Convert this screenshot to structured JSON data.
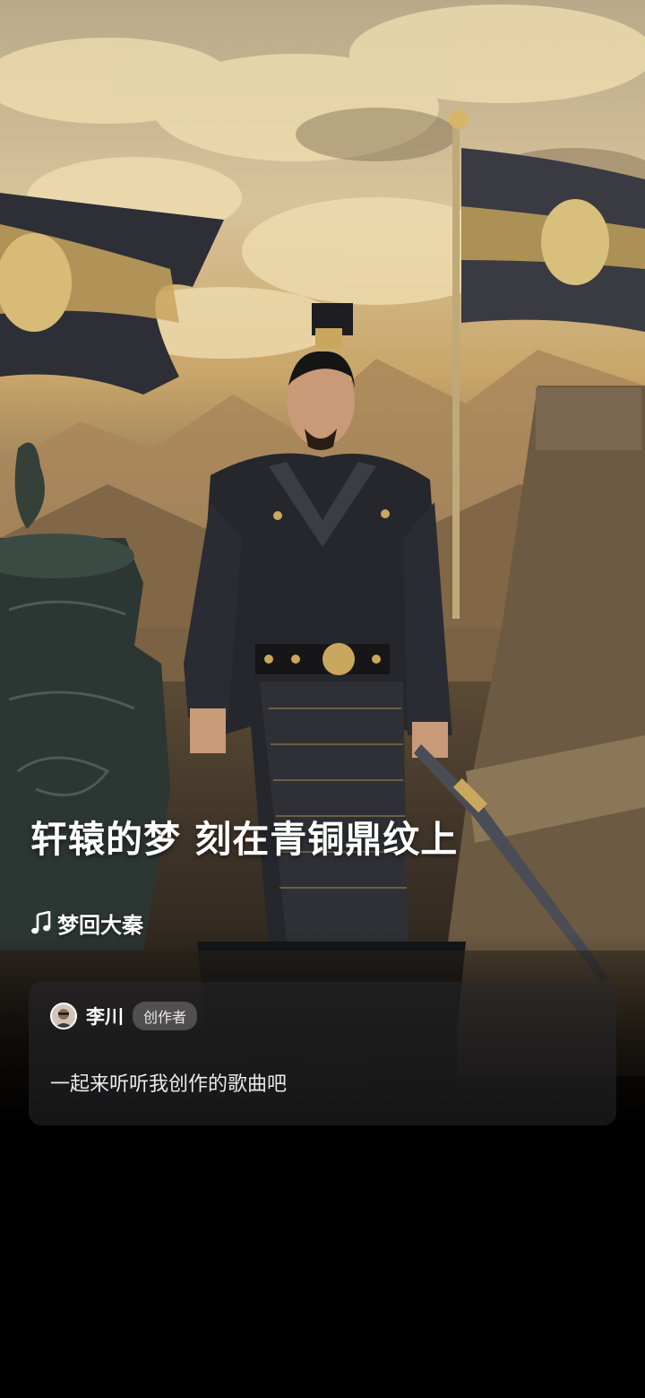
{
  "song": {
    "title": "轩辕的梦 刻在青铜鼎纹上",
    "album": "梦回大秦",
    "album_icon": "music-note-icon"
  },
  "post": {
    "author": "李川",
    "badge": "创作者",
    "text": "一起来听听我创作的歌曲吧"
  }
}
